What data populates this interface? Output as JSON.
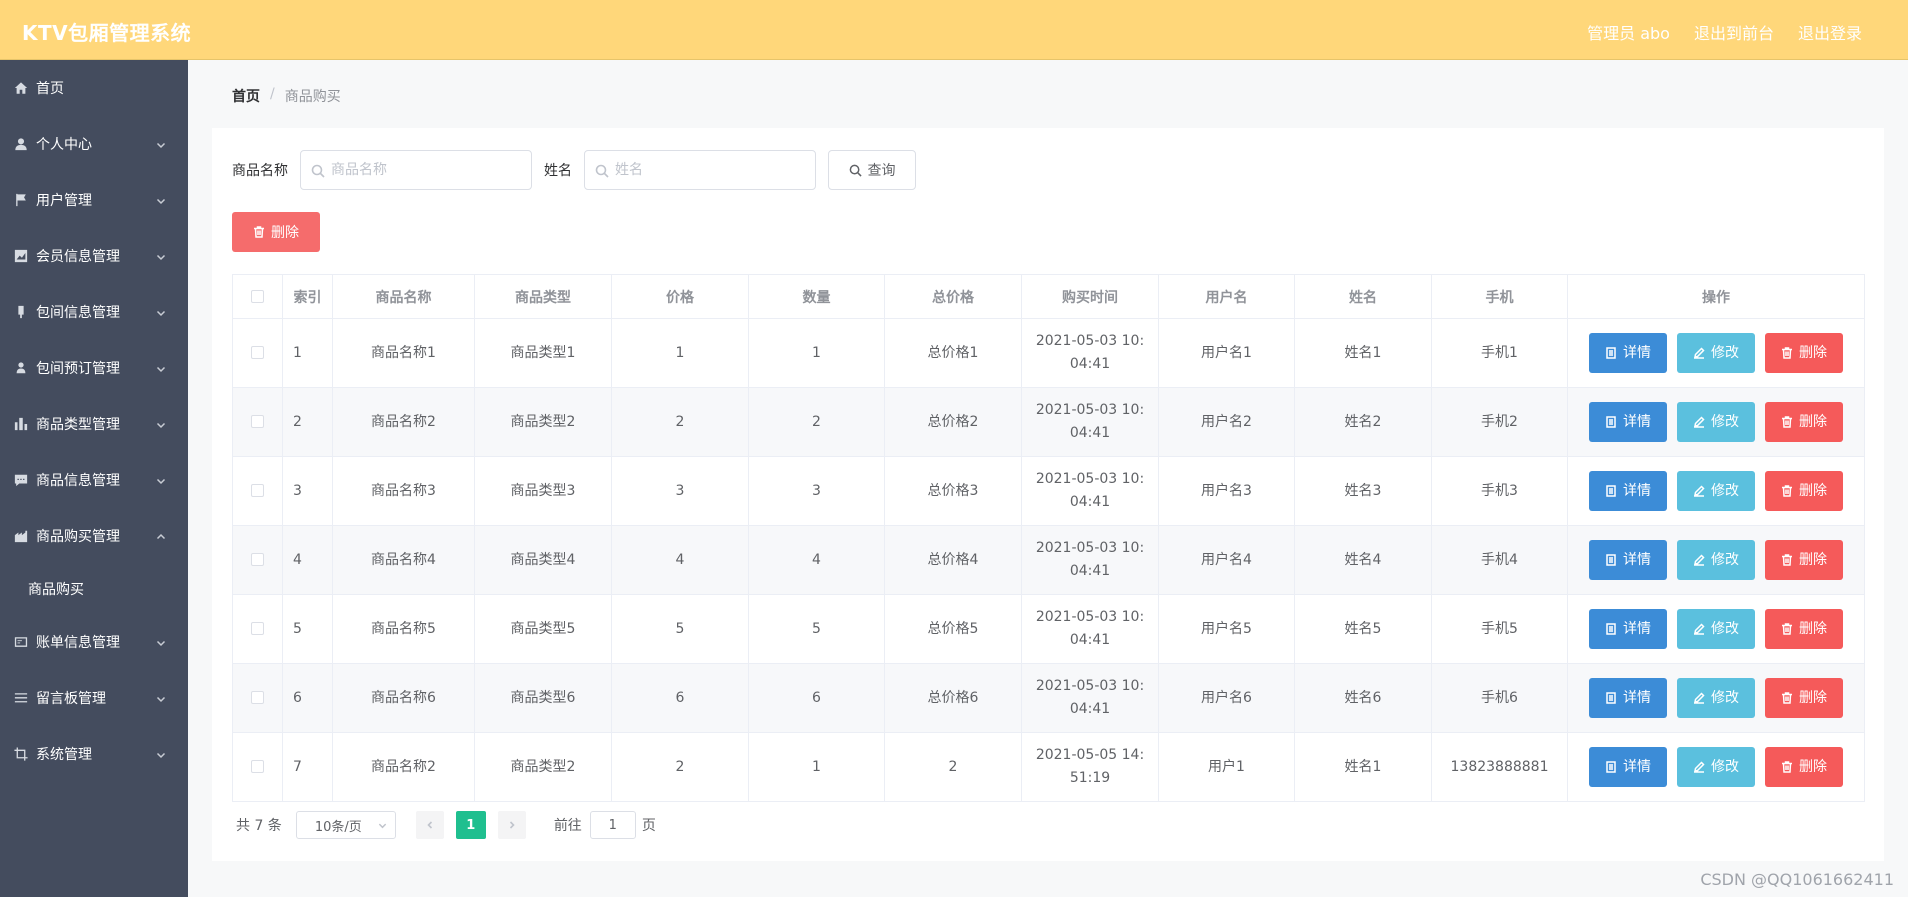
{
  "header": {
    "title": "KTV包厢管理系统",
    "user": "管理员 abo",
    "to_front": "退出到前台",
    "logout": "退出登录"
  },
  "sidebar": {
    "items": [
      {
        "label": "首页",
        "icon": "home-icon",
        "expanded": false,
        "has_children": false
      },
      {
        "label": "个人中心",
        "icon": "user-icon",
        "has_children": true
      },
      {
        "label": "用户管理",
        "icon": "flag-icon",
        "has_children": true
      },
      {
        "label": "会员信息管理",
        "icon": "chart-icon",
        "has_children": true
      },
      {
        "label": "包间信息管理",
        "icon": "device-icon",
        "has_children": true
      },
      {
        "label": "包间预订管理",
        "icon": "person-icon",
        "has_children": true
      },
      {
        "label": "商品类型管理",
        "icon": "bar-chart-icon",
        "has_children": true
      },
      {
        "label": "商品信息管理",
        "icon": "message-icon",
        "has_children": true
      },
      {
        "label": "商品购买管理",
        "icon": "shop-icon",
        "has_children": true,
        "expanded": true,
        "children": [
          "商品购买"
        ]
      },
      {
        "label": "账单信息管理",
        "icon": "bill-icon",
        "has_children": true
      },
      {
        "label": "留言板管理",
        "icon": "list-icon",
        "has_children": true
      },
      {
        "label": "系统管理",
        "icon": "crop-icon",
        "has_children": true
      }
    ]
  },
  "breadcrumb": {
    "home": "首页",
    "sep": "/",
    "current": "商品购买"
  },
  "search": {
    "name_label": "商品名称",
    "name_placeholder": "商品名称",
    "person_label": "姓名",
    "person_placeholder": "姓名",
    "query_label": "查询"
  },
  "batch_delete_label": "删除",
  "table": {
    "headers": [
      "索引",
      "商品名称",
      "商品类型",
      "价格",
      "数量",
      "总价格",
      "购买时间",
      "用户名",
      "姓名",
      "手机",
      "操作"
    ],
    "rows": [
      {
        "idx": "1",
        "name": "商品名称1",
        "type": "商品类型1",
        "price": "1",
        "qty": "1",
        "total": "总价格1",
        "time": "2021-05-03 10:04:41",
        "username": "用户名1",
        "person": "姓名1",
        "phone": "手机1"
      },
      {
        "idx": "2",
        "name": "商品名称2",
        "type": "商品类型2",
        "price": "2",
        "qty": "2",
        "total": "总价格2",
        "time": "2021-05-03 10:04:41",
        "username": "用户名2",
        "person": "姓名2",
        "phone": "手机2"
      },
      {
        "idx": "3",
        "name": "商品名称3",
        "type": "商品类型3",
        "price": "3",
        "qty": "3",
        "total": "总价格3",
        "time": "2021-05-03 10:04:41",
        "username": "用户名3",
        "person": "姓名3",
        "phone": "手机3"
      },
      {
        "idx": "4",
        "name": "商品名称4",
        "type": "商品类型4",
        "price": "4",
        "qty": "4",
        "total": "总价格4",
        "time": "2021-05-03 10:04:41",
        "username": "用户名4",
        "person": "姓名4",
        "phone": "手机4"
      },
      {
        "idx": "5",
        "name": "商品名称5",
        "type": "商品类型5",
        "price": "5",
        "qty": "5",
        "total": "总价格5",
        "time": "2021-05-03 10:04:41",
        "username": "用户名5",
        "person": "姓名5",
        "phone": "手机5"
      },
      {
        "idx": "6",
        "name": "商品名称6",
        "type": "商品类型6",
        "price": "6",
        "qty": "6",
        "total": "总价格6",
        "time": "2021-05-03 10:04:41",
        "username": "用户名6",
        "person": "姓名6",
        "phone": "手机6"
      },
      {
        "idx": "7",
        "name": "商品名称2",
        "type": "商品类型2",
        "price": "2",
        "qty": "1",
        "total": "2",
        "time": "2021-05-05 14:51:19",
        "username": "用户1",
        "person": "姓名1",
        "phone": "13823888881"
      }
    ],
    "actions": {
      "detail": "详情",
      "edit": "修改",
      "delete": "删除"
    }
  },
  "pagination": {
    "total": "共 7 条",
    "page_size": "10条/页",
    "current_page": "1",
    "goto_label": "前往",
    "goto_value": "1",
    "page_suffix": "页"
  },
  "watermark": "CSDN @QQ1061662411",
  "colors": {
    "header_bg": "#ffd77a",
    "sidebar_bg": "#444c5e",
    "detail_btn": "#3c8cd7",
    "edit_btn": "#5bc0de",
    "delete_btn": "#f55a5a",
    "page_active": "#1fbf8f"
  }
}
